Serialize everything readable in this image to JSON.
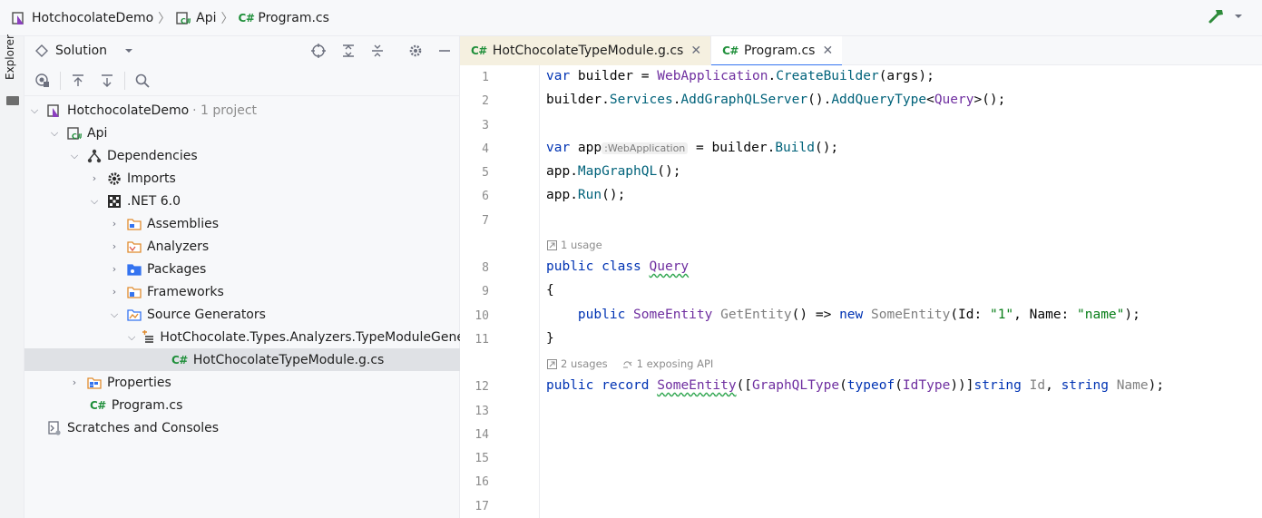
{
  "breadcrumb": {
    "items": [
      {
        "label": "HotchocolateDemo",
        "icon": "solution-icon"
      },
      {
        "label": "Api",
        "icon": "csharp-project-icon"
      },
      {
        "label": "Program.cs",
        "icon": "csharp-file-icon"
      }
    ],
    "cs_badge": "C#"
  },
  "side_strip": {
    "label": "Explorer"
  },
  "explorer": {
    "view_label": "Solution",
    "tree": [
      {
        "label": "HotchocolateDemo",
        "suffix": "· 1 project",
        "icon": "solution-icon"
      },
      {
        "label": "Api",
        "icon": "csharp-project-icon"
      },
      {
        "label": "Dependencies",
        "icon": "dependencies-icon"
      },
      {
        "label": "Imports",
        "icon": "gear-icon"
      },
      {
        "label": ".NET 6.0",
        "icon": "framework-icon"
      },
      {
        "label": "Assemblies",
        "icon": "folder-icon"
      },
      {
        "label": "Analyzers",
        "icon": "folder-icon"
      },
      {
        "label": "Packages",
        "icon": "folder-icon"
      },
      {
        "label": "Frameworks",
        "icon": "folder-icon"
      },
      {
        "label": "Source Generators",
        "icon": "folder-icon"
      },
      {
        "label": "HotChocolate.Types.Analyzers.TypeModuleGene",
        "icon": "generator-icon"
      },
      {
        "label": "HotChocolateTypeModule.g.cs",
        "icon": "csharp-file-icon"
      },
      {
        "label": "Properties",
        "icon": "properties-icon"
      },
      {
        "label": "Program.cs",
        "icon": "csharp-file-icon"
      },
      {
        "label": "Scratches and Consoles",
        "icon": "scratches-icon"
      }
    ]
  },
  "tabs": [
    {
      "label": "HotChocolateTypeModule.g.cs",
      "badge": "C#"
    },
    {
      "label": "Program.cs",
      "badge": "C#"
    }
  ],
  "editor": {
    "line_numbers": [
      "1",
      "2",
      "3",
      "4",
      "5",
      "6",
      "7",
      "8",
      "9",
      "10",
      "11",
      "12",
      "13",
      "14",
      "15",
      "16",
      "17"
    ],
    "code": {
      "l1": {
        "a": "var",
        "b": " builder = ",
        "c": "WebApplication",
        "d": ".",
        "e": "CreateBuilder",
        "f": "(args);"
      },
      "l2": {
        "a": "builder.",
        "b": "Services",
        "c": ".",
        "d": "AddGraphQLServer",
        "e": "().",
        "f": "AddQueryType",
        "g": "<",
        "h": "Query",
        "i": ">();"
      },
      "l4": {
        "a": "var",
        "b": " app",
        "hint": ":WebApplication",
        "c": " = builder.",
        "d": "Build",
        "e": "();"
      },
      "l5": {
        "a": "app.",
        "b": "MapGraphQL",
        "c": "();"
      },
      "l6": {
        "a": "app.",
        "b": "Run",
        "c": "();"
      },
      "l8": {
        "a": "public",
        "b": " ",
        "c": "class",
        "d": " ",
        "e": "Query"
      },
      "l9": {
        "a": "{"
      },
      "l10": {
        "indent": "    ",
        "a": "public",
        "b": " ",
        "c": "SomeEntity",
        "d": " ",
        "e": "GetEntity",
        "f": "() => ",
        "g": "new",
        "h": " ",
        "i": "SomeEntity",
        "j": "(Id: ",
        "k": "\"1\"",
        "l": ", Name: ",
        "m": "\"name\"",
        "n": ");"
      },
      "l11": {
        "a": "}"
      },
      "l12": {
        "a": "public",
        "b": " ",
        "c": "record",
        "d": " ",
        "e": "SomeEntity",
        "f": "([",
        "g": "GraphQLType",
        "h": "(",
        "i": "typeof",
        "j": "(",
        "k": "IdType",
        "l": "))]",
        "m": "string",
        "n": " ",
        "o": "Id",
        "p": ", ",
        "q": "string",
        "r": " ",
        "s": "Name",
        "t": ");"
      }
    },
    "lens": {
      "query_usages": "1 usage",
      "entity_usages": "2 usages",
      "entity_api": "1 exposing API"
    }
  }
}
